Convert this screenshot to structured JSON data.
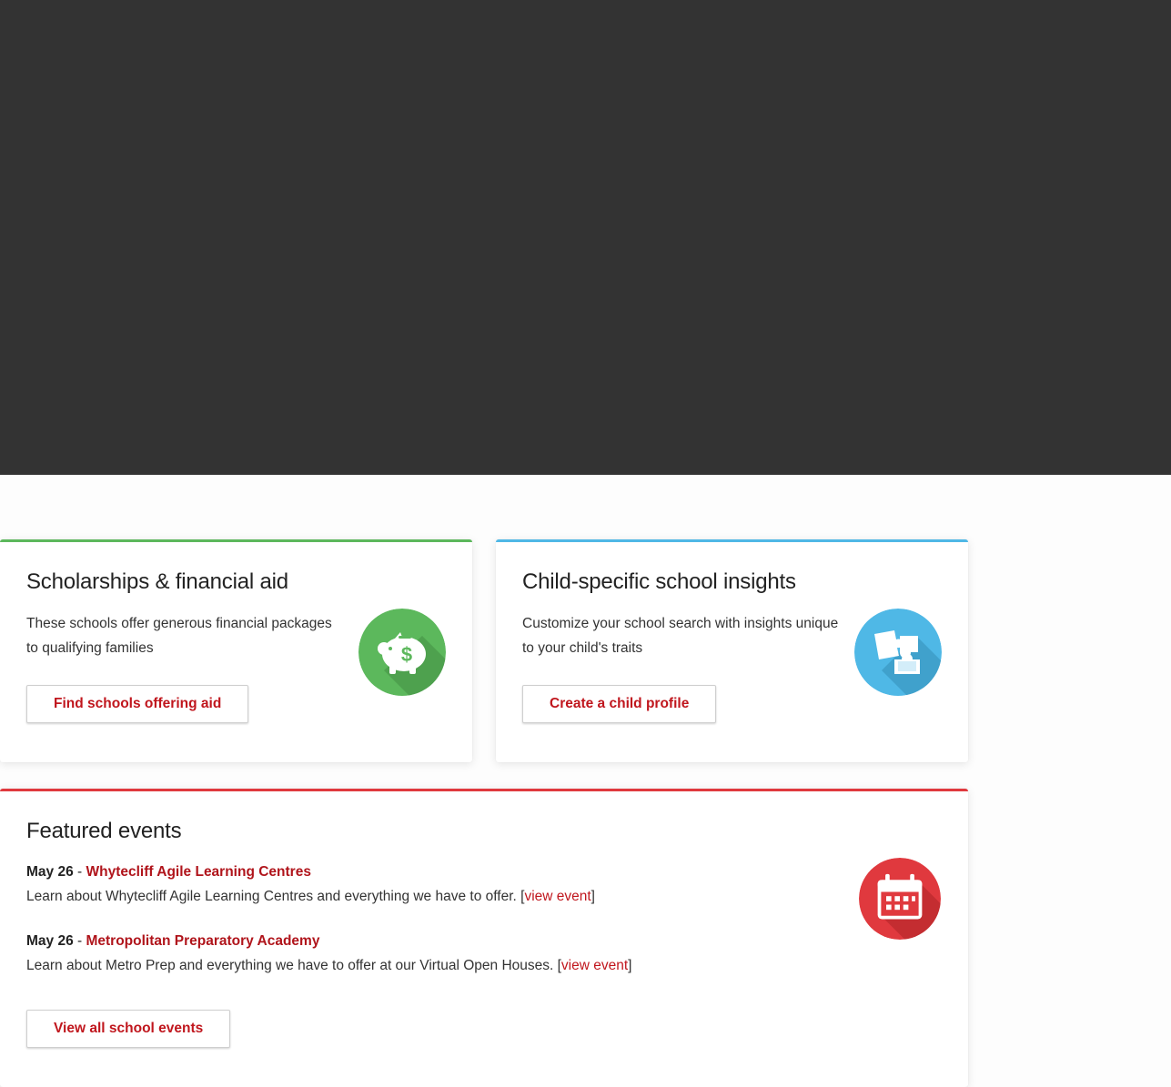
{
  "colors": {
    "hero_background": "#333333",
    "accent_green": "#5cb85c",
    "accent_blue": "#4fb8e6",
    "accent_red": "#e0393e",
    "link_red": "#c0161d"
  },
  "scholarships": {
    "title": "Scholarships & financial aid",
    "description": "These schools offer generous financial packages to qualifying families",
    "button_label": "Find schools offering aid",
    "icon": "piggy-bank-icon"
  },
  "insights": {
    "title": "Child-specific school insights",
    "description": "Customize your school search with insights unique to your child's traits",
    "button_label": "Create a child profile",
    "icon": "puzzle-icon"
  },
  "events": {
    "title": "Featured events",
    "icon": "calendar-icon",
    "items": [
      {
        "date": "May 26",
        "separator": " - ",
        "name": "Whytecliff Agile Learning Centres",
        "description": "Learn about Whytecliff Agile Learning Centres and everything we have to offer. [",
        "link_label": "view event",
        "close": "]"
      },
      {
        "date": "May 26",
        "separator": " - ",
        "name": "Metropolitan Preparatory Academy",
        "description": "Learn about Metro Prep and everything we have to offer at our Virtual Open Houses. [",
        "link_label": "view event",
        "close": "]"
      }
    ],
    "button_label": "View all school events"
  }
}
